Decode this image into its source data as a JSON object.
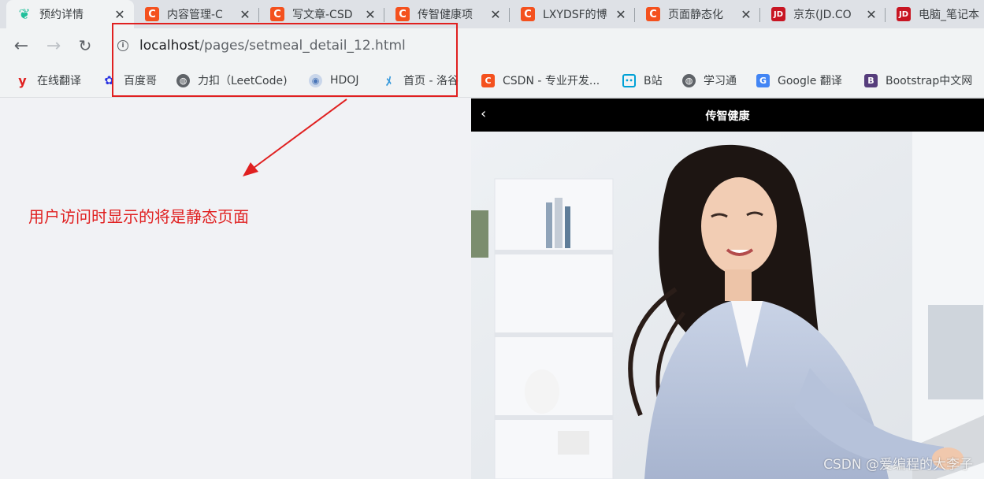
{
  "tabs": [
    {
      "title": "预约详情",
      "icon": "yuyue-icon",
      "active": true
    },
    {
      "title": "内容管理-C",
      "icon": "csdn-icon"
    },
    {
      "title": "写文章-CSD",
      "icon": "csdn-icon"
    },
    {
      "title": "传智健康项",
      "icon": "csdn-icon"
    },
    {
      "title": "LXYDSF的博",
      "icon": "csdn-icon"
    },
    {
      "title": "页面静态化",
      "icon": "csdn-icon"
    },
    {
      "title": "京东(JD.CO",
      "icon": "jd-icon"
    },
    {
      "title": "电脑_笔记本",
      "icon": "jd-icon"
    }
  ],
  "toolbar": {
    "url_host": "localhost",
    "url_path": "/pages/setmeal_detail_12.html"
  },
  "bookmarks": [
    {
      "label": "在线翻译",
      "icon": "youdao-icon",
      "color": "#e02020"
    },
    {
      "label": "百度哥",
      "icon": "baidu-paw-icon",
      "color": "#2932e1"
    },
    {
      "label": "力扣（LeetCode)",
      "icon": "globe-icon",
      "color": "#5f6368"
    },
    {
      "label": "HDOJ",
      "icon": "hdoj-icon",
      "color": "#4a76b8"
    },
    {
      "label": "首页 - 洛谷",
      "icon": "luogu-icon",
      "color": "#3498db"
    },
    {
      "label": "CSDN - 专业开发...",
      "icon": "csdn-icon",
      "color": "#f4511e"
    },
    {
      "label": "B站",
      "icon": "bilibili-icon",
      "color": "#00a1d6"
    },
    {
      "label": "学习通",
      "icon": "globe-icon",
      "color": "#5f6368"
    },
    {
      "label": "Google 翻译",
      "icon": "google-translate-icon",
      "color": "#4285f4"
    },
    {
      "label": "Bootstrap中文网",
      "icon": "bootstrap-icon",
      "color": "#563d7c"
    }
  ],
  "annotation": {
    "text": "用户访问时显示的将是静态页面",
    "color": "#e02020"
  },
  "phone": {
    "title": "传智健康",
    "back_glyph": "‹"
  },
  "watermark": "CSDN @爱编程的大李子"
}
